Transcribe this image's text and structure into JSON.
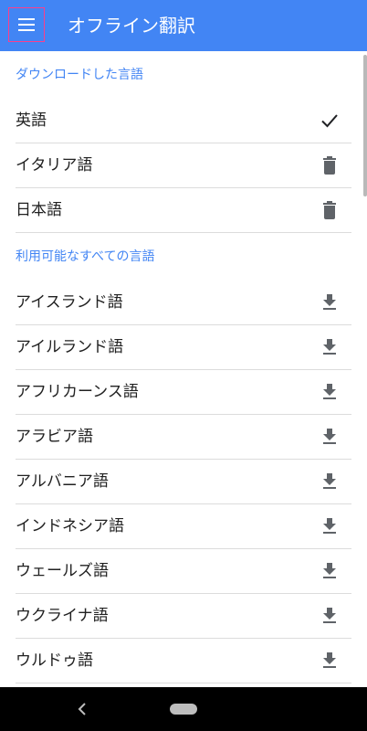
{
  "appbar": {
    "title": "オフライン翻訳",
    "menu_icon": "menu-icon"
  },
  "downloaded": {
    "header": "ダウンロードした言語",
    "items": [
      {
        "label": "英語",
        "icon": "check-icon"
      },
      {
        "label": "イタリア語",
        "icon": "trash-icon"
      },
      {
        "label": "日本語",
        "icon": "trash-icon"
      }
    ]
  },
  "available": {
    "header": "利用可能なすべての言語",
    "items": [
      {
        "label": "アイスランド語",
        "icon": "download-icon"
      },
      {
        "label": "アイルランド語",
        "icon": "download-icon"
      },
      {
        "label": "アフリカーンス語",
        "icon": "download-icon"
      },
      {
        "label": "アラビア語",
        "icon": "download-icon"
      },
      {
        "label": "アルバニア語",
        "icon": "download-icon"
      },
      {
        "label": "インドネシア語",
        "icon": "download-icon"
      },
      {
        "label": "ウェールズ語",
        "icon": "download-icon"
      },
      {
        "label": "ウクライナ語",
        "icon": "download-icon"
      },
      {
        "label": "ウルドゥ語",
        "icon": "download-icon"
      }
    ]
  },
  "colors": {
    "accent": "#4285f4",
    "icon": "#5f6368",
    "text": "#212121"
  }
}
